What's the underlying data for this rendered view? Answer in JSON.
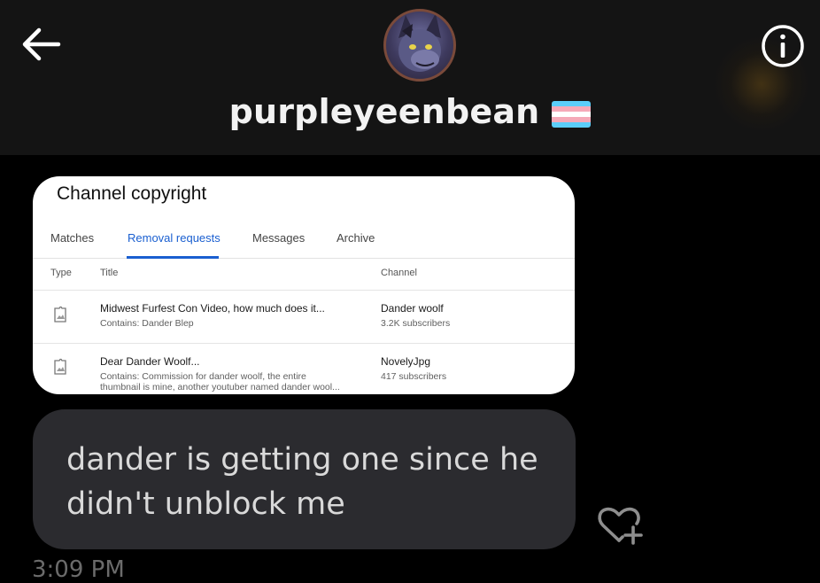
{
  "conversation": {
    "username": "purpleyeenbean",
    "flag_colors": [
      "#5bcefa",
      "#f5a9b8",
      "#ffffff",
      "#f5a9b8",
      "#5bcefa"
    ]
  },
  "icons": {
    "back": "back-arrow-icon",
    "info": "info-icon",
    "react": "heart-plus-icon",
    "type": "image-icon"
  },
  "screenshot_card": {
    "title": "Channel copyright",
    "tabs": [
      "Matches",
      "Removal requests",
      "Messages",
      "Archive"
    ],
    "active_tab": "Removal requests",
    "columns": {
      "type": "Type",
      "title": "Title",
      "channel": "Channel"
    },
    "rows": [
      {
        "title": "Midwest Furfest Con Video, how much does it...",
        "subtitle_line1": "Contains: Dander Blep",
        "subtitle_line2": "",
        "channel": "Dander woolf",
        "subscribers": "3.2K subscribers"
      },
      {
        "title": "Dear Dander Woolf...",
        "subtitle_line1": "Contains: Commission for dander woolf, the entire",
        "subtitle_line2": "thumbnail is mine, another youtuber named dander wool...",
        "channel": "NovelyJpg",
        "subscribers": "417 subscribers"
      }
    ]
  },
  "message": {
    "text_line1": "dander is getting one since he",
    "text_line2": "didn't unblock me",
    "timestamp": "3:09 PM"
  },
  "colors": {
    "background": "#000000",
    "header": "#141414",
    "bubble": "#2b2b2f",
    "link_blue": "#1a5fd0"
  }
}
